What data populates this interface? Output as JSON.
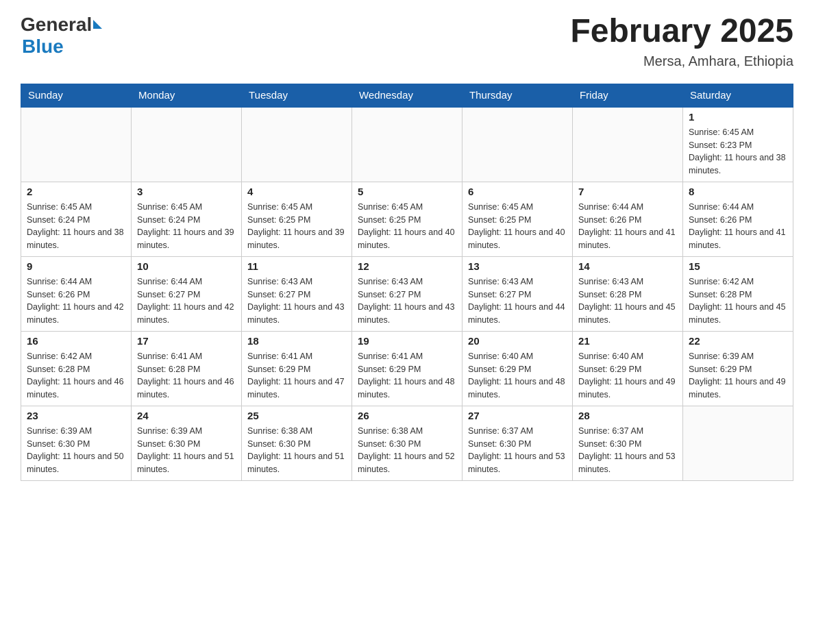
{
  "header": {
    "logo_general": "General",
    "logo_blue": "Blue",
    "title": "February 2025",
    "subtitle": "Mersa, Amhara, Ethiopia"
  },
  "weekdays": [
    "Sunday",
    "Monday",
    "Tuesday",
    "Wednesday",
    "Thursday",
    "Friday",
    "Saturday"
  ],
  "weeks": [
    [
      {
        "day": "",
        "info": ""
      },
      {
        "day": "",
        "info": ""
      },
      {
        "day": "",
        "info": ""
      },
      {
        "day": "",
        "info": ""
      },
      {
        "day": "",
        "info": ""
      },
      {
        "day": "",
        "info": ""
      },
      {
        "day": "1",
        "info": "Sunrise: 6:45 AM\nSunset: 6:23 PM\nDaylight: 11 hours and 38 minutes."
      }
    ],
    [
      {
        "day": "2",
        "info": "Sunrise: 6:45 AM\nSunset: 6:24 PM\nDaylight: 11 hours and 38 minutes."
      },
      {
        "day": "3",
        "info": "Sunrise: 6:45 AM\nSunset: 6:24 PM\nDaylight: 11 hours and 39 minutes."
      },
      {
        "day": "4",
        "info": "Sunrise: 6:45 AM\nSunset: 6:25 PM\nDaylight: 11 hours and 39 minutes."
      },
      {
        "day": "5",
        "info": "Sunrise: 6:45 AM\nSunset: 6:25 PM\nDaylight: 11 hours and 40 minutes."
      },
      {
        "day": "6",
        "info": "Sunrise: 6:45 AM\nSunset: 6:25 PM\nDaylight: 11 hours and 40 minutes."
      },
      {
        "day": "7",
        "info": "Sunrise: 6:44 AM\nSunset: 6:26 PM\nDaylight: 11 hours and 41 minutes."
      },
      {
        "day": "8",
        "info": "Sunrise: 6:44 AM\nSunset: 6:26 PM\nDaylight: 11 hours and 41 minutes."
      }
    ],
    [
      {
        "day": "9",
        "info": "Sunrise: 6:44 AM\nSunset: 6:26 PM\nDaylight: 11 hours and 42 minutes."
      },
      {
        "day": "10",
        "info": "Sunrise: 6:44 AM\nSunset: 6:27 PM\nDaylight: 11 hours and 42 minutes."
      },
      {
        "day": "11",
        "info": "Sunrise: 6:43 AM\nSunset: 6:27 PM\nDaylight: 11 hours and 43 minutes."
      },
      {
        "day": "12",
        "info": "Sunrise: 6:43 AM\nSunset: 6:27 PM\nDaylight: 11 hours and 43 minutes."
      },
      {
        "day": "13",
        "info": "Sunrise: 6:43 AM\nSunset: 6:27 PM\nDaylight: 11 hours and 44 minutes."
      },
      {
        "day": "14",
        "info": "Sunrise: 6:43 AM\nSunset: 6:28 PM\nDaylight: 11 hours and 45 minutes."
      },
      {
        "day": "15",
        "info": "Sunrise: 6:42 AM\nSunset: 6:28 PM\nDaylight: 11 hours and 45 minutes."
      }
    ],
    [
      {
        "day": "16",
        "info": "Sunrise: 6:42 AM\nSunset: 6:28 PM\nDaylight: 11 hours and 46 minutes."
      },
      {
        "day": "17",
        "info": "Sunrise: 6:41 AM\nSunset: 6:28 PM\nDaylight: 11 hours and 46 minutes."
      },
      {
        "day": "18",
        "info": "Sunrise: 6:41 AM\nSunset: 6:29 PM\nDaylight: 11 hours and 47 minutes."
      },
      {
        "day": "19",
        "info": "Sunrise: 6:41 AM\nSunset: 6:29 PM\nDaylight: 11 hours and 48 minutes."
      },
      {
        "day": "20",
        "info": "Sunrise: 6:40 AM\nSunset: 6:29 PM\nDaylight: 11 hours and 48 minutes."
      },
      {
        "day": "21",
        "info": "Sunrise: 6:40 AM\nSunset: 6:29 PM\nDaylight: 11 hours and 49 minutes."
      },
      {
        "day": "22",
        "info": "Sunrise: 6:39 AM\nSunset: 6:29 PM\nDaylight: 11 hours and 49 minutes."
      }
    ],
    [
      {
        "day": "23",
        "info": "Sunrise: 6:39 AM\nSunset: 6:30 PM\nDaylight: 11 hours and 50 minutes."
      },
      {
        "day": "24",
        "info": "Sunrise: 6:39 AM\nSunset: 6:30 PM\nDaylight: 11 hours and 51 minutes."
      },
      {
        "day": "25",
        "info": "Sunrise: 6:38 AM\nSunset: 6:30 PM\nDaylight: 11 hours and 51 minutes."
      },
      {
        "day": "26",
        "info": "Sunrise: 6:38 AM\nSunset: 6:30 PM\nDaylight: 11 hours and 52 minutes."
      },
      {
        "day": "27",
        "info": "Sunrise: 6:37 AM\nSunset: 6:30 PM\nDaylight: 11 hours and 53 minutes."
      },
      {
        "day": "28",
        "info": "Sunrise: 6:37 AM\nSunset: 6:30 PM\nDaylight: 11 hours and 53 minutes."
      },
      {
        "day": "",
        "info": ""
      }
    ]
  ]
}
